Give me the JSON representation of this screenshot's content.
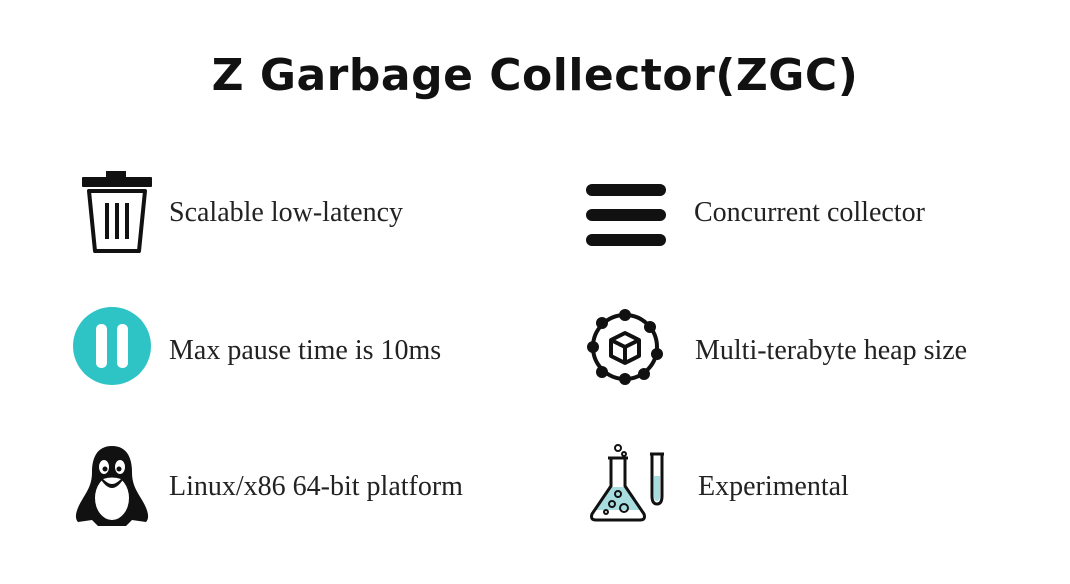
{
  "title": "Z Garbage Collector(ZGC)",
  "features": [
    {
      "icon": "trash-icon",
      "label": "Scalable low-latency"
    },
    {
      "icon": "menu-bars-icon",
      "label": "Concurrent collector"
    },
    {
      "icon": "pause-icon",
      "label": "Max pause time is 10ms"
    },
    {
      "icon": "network-cube-icon",
      "label": "Multi-terabyte heap size"
    },
    {
      "icon": "linux-penguin-icon",
      "label": "Linux/x86 64-bit platform"
    },
    {
      "icon": "flask-icon",
      "label": "Experimental"
    }
  ],
  "colors": {
    "pause_accent": "#2ec4c6",
    "liquid_accent": "#a8dde0",
    "text": "#222222",
    "icon": "#111111"
  }
}
